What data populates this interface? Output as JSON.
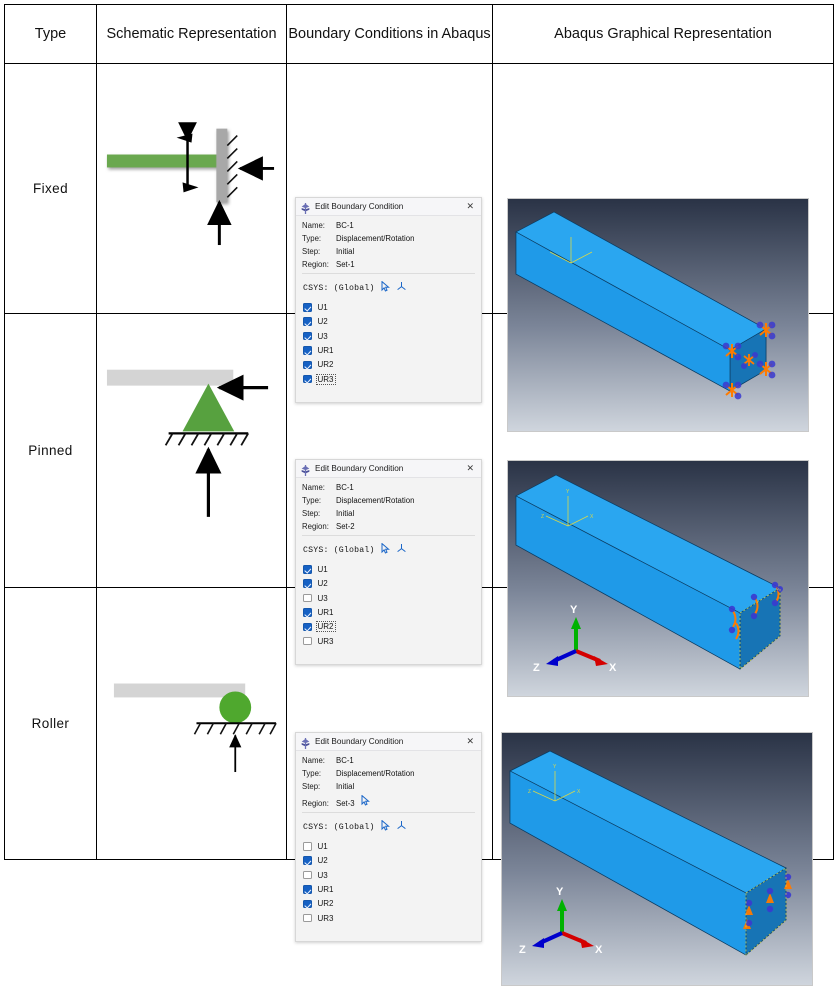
{
  "table": {
    "headers": [
      "Type",
      "Schematic Representation",
      "Boundary Conditions in Abaqus",
      "Abaqus Graphical Representation"
    ],
    "rows": [
      {
        "type": "Fixed",
        "schematic": {
          "beam_color": "#6aa84f",
          "wall_color": "#a8a8a8",
          "elements": [
            "green-horizontal-beam",
            "hatched-vertical-wall",
            "moment-double-arrow",
            "horizontal-reaction-arrow",
            "vertical-reaction-arrow"
          ]
        },
        "dialog": {
          "title": "Edit Boundary Condition",
          "close_label": "✕",
          "fields": [
            {
              "key": "Name:",
              "value": "BC-1"
            },
            {
              "key": "Type:",
              "value": "Displacement/Rotation"
            },
            {
              "key": "Step:",
              "value": "Initial"
            },
            {
              "key": "Region:",
              "value": "Set-1"
            }
          ],
          "csys_label": "CSYS:  (Global)",
          "dofs": [
            {
              "label": "U1",
              "checked": true,
              "focused": false
            },
            {
              "label": "U2",
              "checked": true,
              "focused": false
            },
            {
              "label": "U3",
              "checked": true,
              "focused": false
            },
            {
              "label": "UR1",
              "checked": true,
              "focused": false
            },
            {
              "label": "UR2",
              "checked": true,
              "focused": false
            },
            {
              "label": "UR3",
              "checked": true,
              "focused": true
            }
          ],
          "show_region_cursor": false
        },
        "viewport": {
          "triad_labels": [],
          "show_big_triad": false,
          "bc_marker_style": "encastre-arrow-cluster"
        }
      },
      {
        "type": "Pinned",
        "schematic": {
          "beam_color": "#d4d4d4",
          "support_color": "#57a13f",
          "elements": [
            "gray-horizontal-beam",
            "green-triangle-support",
            "hatched-ground-line",
            "horizontal-reaction-arrow",
            "vertical-reaction-arrow"
          ]
        },
        "dialog": {
          "title": "Edit Boundary Condition",
          "close_label": "✕",
          "fields": [
            {
              "key": "Name:",
              "value": "BC-1"
            },
            {
              "key": "Type:",
              "value": "Displacement/Rotation"
            },
            {
              "key": "Step:",
              "value": "Initial"
            },
            {
              "key": "Region:",
              "value": "Set-2"
            }
          ],
          "csys_label": "CSYS:  (Global)",
          "dofs": [
            {
              "label": "U1",
              "checked": true,
              "focused": false
            },
            {
              "label": "U2",
              "checked": true,
              "focused": false
            },
            {
              "label": "U3",
              "checked": false,
              "focused": false
            },
            {
              "label": "UR1",
              "checked": true,
              "focused": false
            },
            {
              "label": "UR2",
              "checked": true,
              "focused": true
            },
            {
              "label": "UR3",
              "checked": false,
              "focused": false
            }
          ],
          "show_region_cursor": false
        },
        "viewport": {
          "triad_labels": [
            "Y",
            "Z",
            "X"
          ],
          "show_big_triad": true,
          "bc_marker_style": "pinned-arrow-cluster"
        }
      },
      {
        "type": "Roller",
        "schematic": {
          "beam_color": "#d4d4d4",
          "support_color": "#4fa82e",
          "elements": [
            "gray-horizontal-beam",
            "green-circle-roller",
            "hatched-ground-line",
            "vertical-reaction-arrow"
          ]
        },
        "dialog": {
          "title": "Edit Boundary Condition",
          "close_label": "✕",
          "fields": [
            {
              "key": "Name:",
              "value": "BC-1"
            },
            {
              "key": "Type:",
              "value": "Displacement/Rotation"
            },
            {
              "key": "Step:",
              "value": "Initial"
            },
            {
              "key": "Region:",
              "value": "Set-3"
            }
          ],
          "csys_label": "CSYS:  (Global)",
          "dofs": [
            {
              "label": "U1",
              "checked": false,
              "focused": false
            },
            {
              "label": "U2",
              "checked": true,
              "focused": false
            },
            {
              "label": "U3",
              "checked": false,
              "focused": false
            },
            {
              "label": "UR1",
              "checked": true,
              "focused": false
            },
            {
              "label": "UR2",
              "checked": true,
              "focused": false
            },
            {
              "label": "UR3",
              "checked": false,
              "focused": false
            }
          ],
          "show_region_cursor": true
        },
        "viewport": {
          "triad_labels": [
            "Y",
            "Z",
            "X"
          ],
          "show_big_triad": true,
          "bc_marker_style": "roller-arrow-cluster"
        }
      }
    ]
  },
  "colors": {
    "checkbox_on": "#1661c4",
    "beam_blue": "#1f9ae8",
    "beam_blue_dark": "#1573b5",
    "bc_marker_orange": "#ff7b00",
    "bc_marker_blue": "#3a3ad0",
    "triad_y": "#00b200",
    "triad_x": "#d40000",
    "triad_z": "#0000cc",
    "green_support": "#6aa84f",
    "gray_beam": "#d4d4d4"
  }
}
